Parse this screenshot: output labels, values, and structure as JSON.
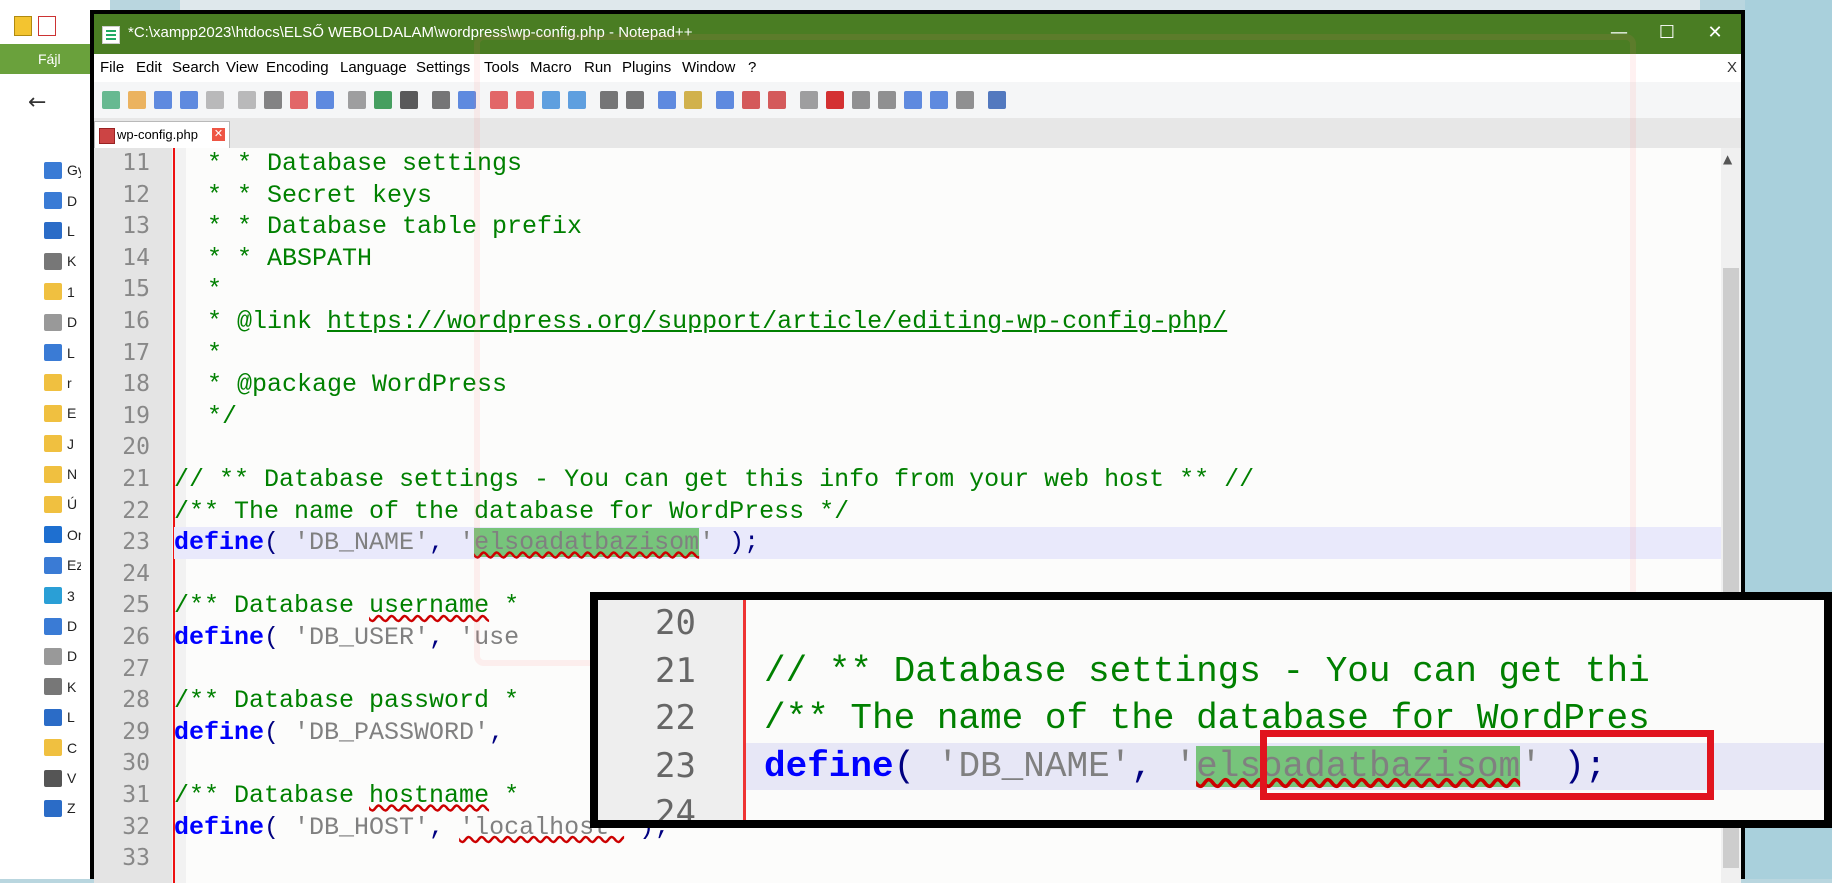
{
  "background": {
    "left_menu_label": "Fájl",
    "nav_items": [
      {
        "label": "Gy",
        "color": "#3a7bd5"
      },
      {
        "label": "D",
        "color": "#3a7bd5"
      },
      {
        "label": "L",
        "color": "#2b6cc7"
      },
      {
        "label": "K",
        "color": "#777777"
      },
      {
        "label": "1",
        "color": "#f0c040"
      },
      {
        "label": "D",
        "color": "#999999"
      },
      {
        "label": "L",
        "color": "#3a7bd5"
      },
      {
        "label": "r",
        "color": "#f0c040"
      },
      {
        "label": "E",
        "color": "#f0c040"
      },
      {
        "label": "J",
        "color": "#f0c040"
      },
      {
        "label": "N",
        "color": "#f0c040"
      },
      {
        "label": "Ú",
        "color": "#f0c040"
      },
      {
        "label": "Or",
        "color": "#1e6fd0"
      },
      {
        "label": "Ez",
        "color": "#3a7bd5"
      },
      {
        "label": "3",
        "color": "#2a9fd6"
      },
      {
        "label": "D",
        "color": "#3a7bd5"
      },
      {
        "label": "D",
        "color": "#999999"
      },
      {
        "label": "K",
        "color": "#777777"
      },
      {
        "label": "L",
        "color": "#2b6cc7"
      },
      {
        "label": "C",
        "color": "#f0c040"
      },
      {
        "label": "V",
        "color": "#555555"
      },
      {
        "label": "Z",
        "color": "#2b6cc7"
      }
    ]
  },
  "window": {
    "title": "*C:\\xampp2023\\htdocs\\ELSŐ WEBOLDALAM\\wordpress\\wp-config.php - Notepad++",
    "minimize": "—",
    "maximize": "☐",
    "close": "✕"
  },
  "menu": {
    "items": [
      "File",
      "Edit",
      "Search",
      "View",
      "Encoding",
      "Language",
      "Settings",
      "Tools",
      "Macro",
      "Run",
      "Plugins",
      "Window",
      "?"
    ],
    "close_doc": "X"
  },
  "tab": {
    "label": "wp-config.php",
    "close": "✕"
  },
  "editor": {
    "lines": [
      {
        "n": "11"
      },
      {
        "n": "12"
      },
      {
        "n": "13"
      },
      {
        "n": "14"
      },
      {
        "n": "15"
      },
      {
        "n": "16"
      },
      {
        "n": "17"
      },
      {
        "n": "18"
      },
      {
        "n": "19"
      },
      {
        "n": "20"
      },
      {
        "n": "21"
      },
      {
        "n": "22"
      },
      {
        "n": "23"
      },
      {
        "n": "24"
      },
      {
        "n": "25"
      },
      {
        "n": "26"
      },
      {
        "n": "27"
      },
      {
        "n": "28"
      },
      {
        "n": "29"
      },
      {
        "n": "30"
      },
      {
        "n": "31"
      },
      {
        "n": "32"
      },
      {
        "n": "33"
      }
    ],
    "text": {
      "l11": " * * Database settings",
      "l12": " * * Secret keys",
      "l13": " * * Database table prefix",
      "l14": " * * ABSPATH",
      "l15": " *",
      "l16_pre": " * @link ",
      "l16_link": "https://wordpress.org/support/article/editing-wp-config-php/",
      "l17": " *",
      "l18": " * @package WordPress",
      "l19": " */",
      "l21": "// ** Database settings - You can get this info from your web host ** //",
      "l22": "/** The name of the database for WordPress */",
      "define": "define",
      "open": "( ",
      "comma": ", ",
      "close": " );",
      "l23_key": "'DB_NAME'",
      "quote": "'",
      "l23_val": "elsoadatbazisom",
      "l25_a": "/** Database ",
      "l25_b": "username",
      "l25_c": " *",
      "l26_key": "'DB_USER'",
      "l26_tail": "'use",
      "l28": "/** Database password *",
      "l29_key": "'DB_PASSWORD'",
      "l31_a": "/** Database ",
      "l31_b": "hostname",
      "l31_c": " *",
      "l32_key": "'DB_HOST'",
      "l32_val": "'localhost'"
    }
  },
  "zoom": {
    "nums": [
      "20",
      "21",
      "22",
      "23",
      "24"
    ],
    "l21": "// ** Database settings - You can get thi",
    "l22": "/** The name of the database for WordPres",
    "define": "define",
    "open": "( ",
    "key": "'DB_NAME'",
    "comma": ", ",
    "quote": "'",
    "val": "elsoadatbazisom",
    "close": " );"
  }
}
